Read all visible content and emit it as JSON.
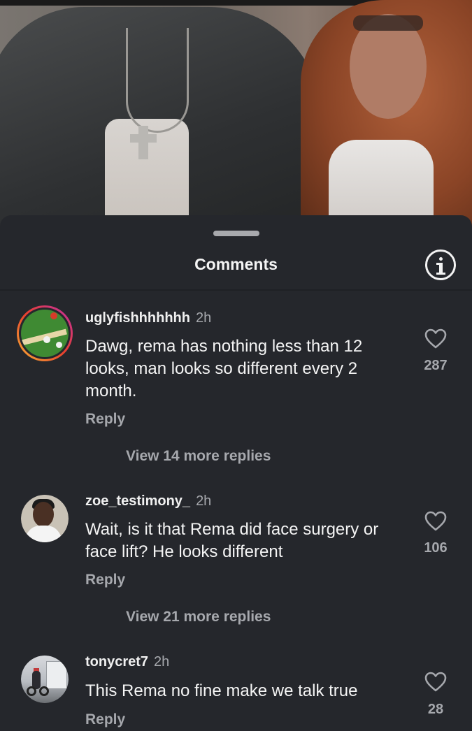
{
  "sheet": {
    "title": "Comments"
  },
  "comments": [
    {
      "username": "uglyfishhhhhhh",
      "time": "2h",
      "text": "Dawg, rema has nothing less than 12 looks, man looks so different every 2 month.",
      "likes": "287",
      "reply_label": "Reply",
      "view_replies": "View 14 more replies"
    },
    {
      "username": "zoe_testimony_",
      "time": "2h",
      "text": "Wait, is it that Rema did face surgery or face lift? He looks different",
      "likes": "106",
      "reply_label": "Reply",
      "view_replies": "View 21 more replies"
    },
    {
      "username": "tonycret7",
      "time": "2h",
      "text": "This Rema no fine make we talk true",
      "likes": "28",
      "reply_label": "Reply"
    }
  ],
  "icons": {
    "info": "info-icon",
    "like": "heart-icon"
  },
  "colors": {
    "sheet_bg": "#25272c",
    "muted_text": "#a6a8ad",
    "primary_text": "#f4f4f4",
    "story_ring": "#e8402e"
  }
}
